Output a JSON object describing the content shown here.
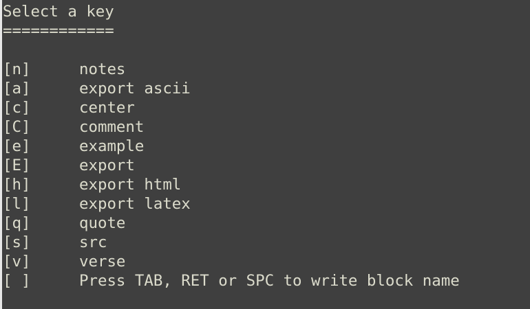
{
  "menu": {
    "title": "Select a key",
    "underline": "============",
    "items": [
      {
        "key": "[n]",
        "label": "notes"
      },
      {
        "key": "[a]",
        "label": "export ascii"
      },
      {
        "key": "[c]",
        "label": "center"
      },
      {
        "key": "[C]",
        "label": "comment"
      },
      {
        "key": "[e]",
        "label": "example"
      },
      {
        "key": "[E]",
        "label": "export"
      },
      {
        "key": "[h]",
        "label": "export html"
      },
      {
        "key": "[l]",
        "label": "export latex"
      },
      {
        "key": "[q]",
        "label": "quote"
      },
      {
        "key": "[s]",
        "label": "src"
      },
      {
        "key": "[v]",
        "label": "verse"
      },
      {
        "key": "[ ]",
        "label": "Press TAB, RET or SPC to write block name"
      }
    ]
  },
  "colors": {
    "background": "#3f3f3f",
    "text": "#dcdccc",
    "edge": "#e8e8e8"
  }
}
